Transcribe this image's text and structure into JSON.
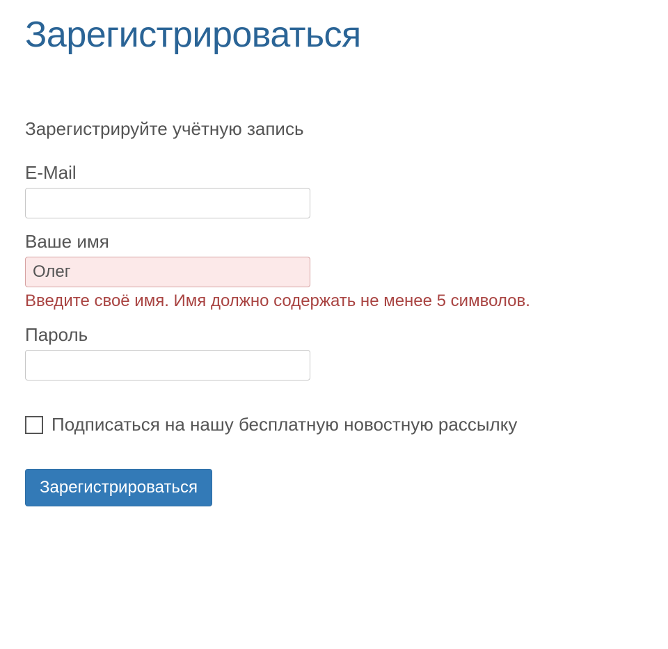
{
  "page": {
    "title": "Зарегистрироваться",
    "subtitle": "Зарегистрируйте учётную запись"
  },
  "form": {
    "email": {
      "label": "E-Mail",
      "value": ""
    },
    "name": {
      "label": "Ваше имя",
      "value": "Олег",
      "error": "Введите своё имя. Имя должно содержать не менее 5 символов."
    },
    "password": {
      "label": "Пароль",
      "value": ""
    },
    "newsletter": {
      "label": "Подписаться на нашу бесплатную новостную рассылку",
      "checked": false
    },
    "submit": "Зарегистрироваться"
  }
}
